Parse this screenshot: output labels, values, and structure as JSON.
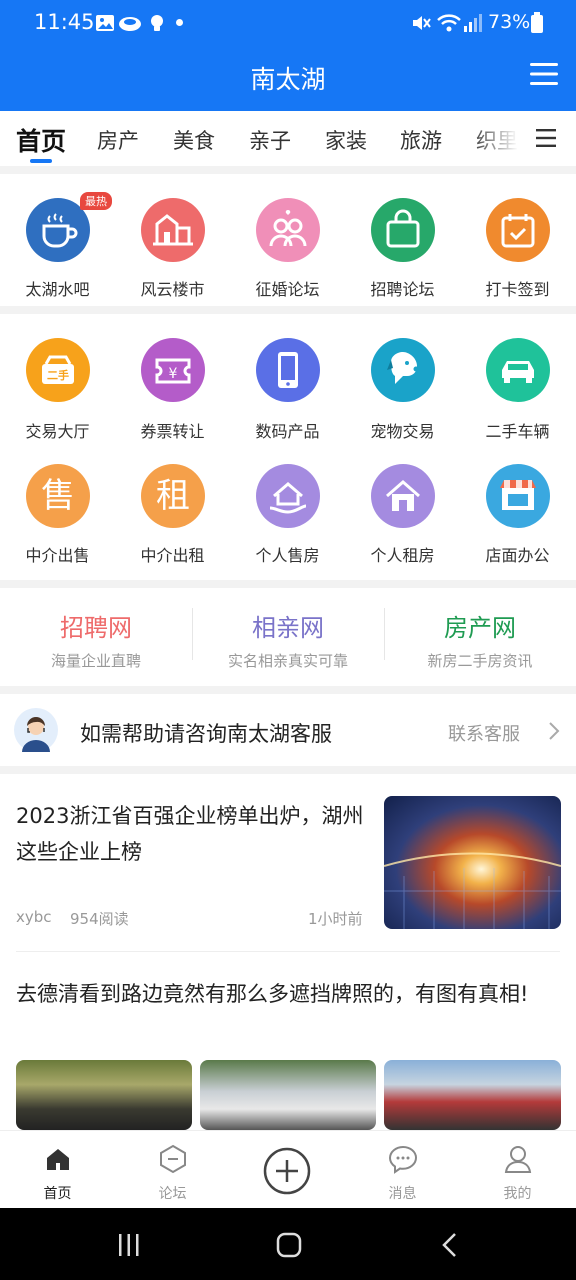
{
  "status": {
    "time": "11:45",
    "battery": "73%"
  },
  "header": {
    "title": "南太湖"
  },
  "tabs": [
    {
      "label": "首页",
      "active": true
    },
    {
      "label": "房产"
    },
    {
      "label": "美食"
    },
    {
      "label": "亲子"
    },
    {
      "label": "家装"
    },
    {
      "label": "旅游"
    },
    {
      "label": "织里"
    }
  ],
  "forums": [
    {
      "label": "太湖水吧",
      "icon": "coffee-cup-icon",
      "color": "#2f6fc0",
      "badge": "最热"
    },
    {
      "label": "风云楼市",
      "icon": "buildings-icon",
      "color": "#ee6b6b"
    },
    {
      "label": "征婚论坛",
      "icon": "couple-icon",
      "color": "#f08fb8"
    },
    {
      "label": "招聘论坛",
      "icon": "briefcase-icon",
      "color": "#27a86a"
    },
    {
      "label": "打卡签到",
      "icon": "calendar-check-icon",
      "color": "#f08a2e"
    }
  ],
  "services": [
    {
      "label": "交易大厅",
      "icon": "secondhand-box-icon",
      "color": "#f7a21b",
      "text": "二手"
    },
    {
      "label": "券票转让",
      "icon": "ticket-icon",
      "color": "#b45cc9",
      "text": "¥"
    },
    {
      "label": "数码产品",
      "icon": "smartphone-icon",
      "color": "#5a6fe6"
    },
    {
      "label": "宠物交易",
      "icon": "dog-icon",
      "color": "#1aa3c9"
    },
    {
      "label": "二手车辆",
      "icon": "car-icon",
      "color": "#1fc29a"
    },
    {
      "label": "中介出售",
      "icon": "sell-char-icon",
      "color": "#f5a04a",
      "text": "售"
    },
    {
      "label": "中介出租",
      "icon": "rent-char-icon",
      "color": "#f5a04a",
      "text": "租"
    },
    {
      "label": "个人售房",
      "icon": "house-hand-icon",
      "color": "#a48be0"
    },
    {
      "label": "个人租房",
      "icon": "house-icon",
      "color": "#a48be0"
    },
    {
      "label": "店面办公",
      "icon": "storefront-icon",
      "color": "#3aa8e0"
    }
  ],
  "portals": [
    {
      "title": "招聘网",
      "subtitle": "海量企业直聘",
      "color": "#ee6b6b"
    },
    {
      "title": "相亲网",
      "subtitle": "实名相亲真实可靠",
      "color": "#7a73c9"
    },
    {
      "title": "房产网",
      "subtitle": "新房二手房资讯",
      "color": "#1f9b52"
    }
  ],
  "service": {
    "text": "如需帮助请咨询南太湖客服",
    "link": "联系客服"
  },
  "articles": [
    {
      "title": "2023浙江省百强企业榜单出炉，湖州这些企业上榜",
      "author": "xybc",
      "reads": "954阅读",
      "time": "1小时前"
    },
    {
      "title": "去德清看到路边竟然有那么多遮挡牌照的，有图有真相!"
    }
  ],
  "bottom_nav": [
    {
      "label": "首页",
      "icon": "home-icon",
      "active": true
    },
    {
      "label": "论坛",
      "icon": "forum-hexagon-icon"
    },
    {
      "label": "",
      "icon": "plus-circle-icon"
    },
    {
      "label": "消息",
      "icon": "chat-bubble-icon"
    },
    {
      "label": "我的",
      "icon": "profile-icon"
    }
  ]
}
